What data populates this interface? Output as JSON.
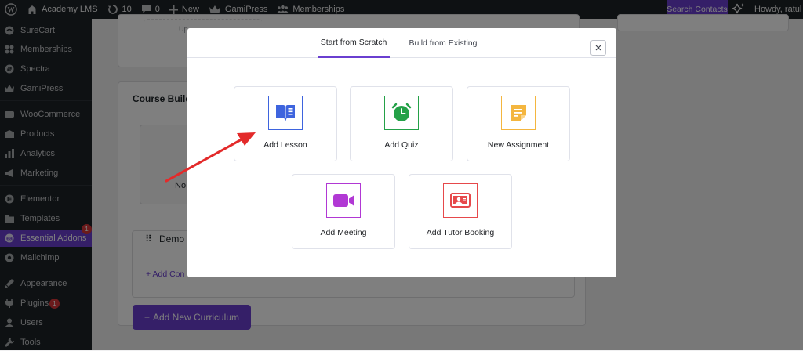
{
  "adminbar": {
    "site_name": "Academy LMS",
    "updates_count": "10",
    "comments_count": "0",
    "new_label": "New",
    "gamipress_label": "GamiPress",
    "memberships_label": "Memberships",
    "search_contacts_label": "Search Contacts",
    "howdy_label": "Howdy, ratul"
  },
  "sidebar": {
    "items": [
      {
        "label": "SureCart",
        "icon": "surecart-icon"
      },
      {
        "label": "Memberships",
        "icon": "memberships-icon"
      },
      {
        "label": "Spectra",
        "icon": "spectra-icon"
      },
      {
        "label": "GamiPress",
        "icon": "gamipress-icon"
      },
      {
        "label": "WooCommerce",
        "icon": "woocommerce-icon"
      },
      {
        "label": "Products",
        "icon": "products-icon"
      },
      {
        "label": "Analytics",
        "icon": "analytics-icon"
      },
      {
        "label": "Marketing",
        "icon": "marketing-icon"
      },
      {
        "label": "Elementor",
        "icon": "elementor-icon"
      },
      {
        "label": "Templates",
        "icon": "templates-icon"
      },
      {
        "label": "Essential Addons",
        "icon": "essential-addons-icon",
        "badge": "1",
        "active": true
      },
      {
        "label": "Mailchimp",
        "icon": "mailchimp-icon"
      },
      {
        "label": "Appearance",
        "icon": "appearance-icon"
      },
      {
        "label": "Plugins",
        "icon": "plugins-icon",
        "badge": "1"
      },
      {
        "label": "Users",
        "icon": "users-icon"
      },
      {
        "label": "Tools",
        "icon": "tools-icon"
      }
    ]
  },
  "background": {
    "upload_partial": "Up",
    "course_builder_partial": "Course Build",
    "no_partial": "No",
    "demo_partial": "Demo",
    "add_content_partial": "+ Add Con",
    "add_new_curriculum": "Add New Curriculum"
  },
  "modal": {
    "tabs": [
      "Start from Scratch",
      "Build from Existing"
    ],
    "active_tab": "Start from Scratch",
    "options": [
      {
        "label": "Add Lesson",
        "icon": "lesson-book-icon",
        "color": "#3e64de"
      },
      {
        "label": "Add Quiz",
        "icon": "quiz-alarm-icon",
        "color": "#24a148"
      },
      {
        "label": "New Assignment",
        "icon": "assignment-note-icon",
        "color": "#f4b63f"
      },
      {
        "label": "Add Meeting",
        "icon": "meeting-video-icon",
        "color": "#b138d4"
      },
      {
        "label": "Add Tutor Booking",
        "icon": "tutor-booking-icon",
        "color": "#e6494b"
      }
    ]
  },
  "colors": {
    "accent": "#6a3fd0",
    "annotation_arrow": "#e32a2a"
  }
}
